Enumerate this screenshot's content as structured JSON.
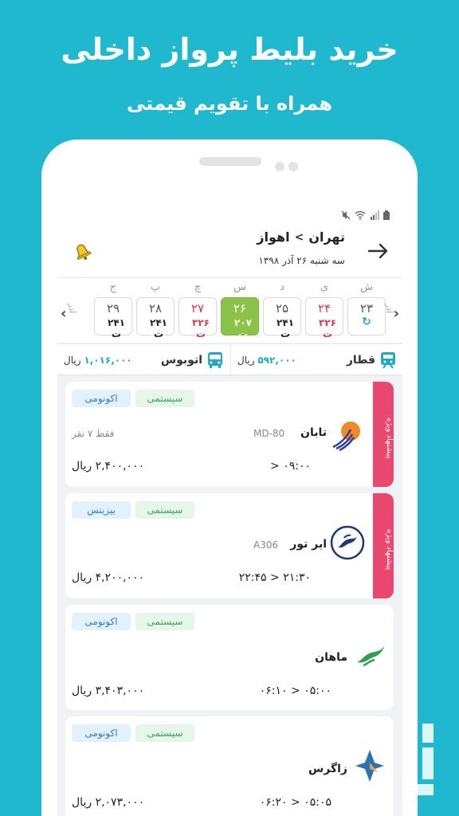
{
  "promo": {
    "title": "خرید بلیط پرواز داخلی",
    "subtitle": "همراه با تقویم قیمتی"
  },
  "header": {
    "origin": "تهران",
    "separator": ">",
    "destination": "اهواز",
    "date": "سه شنبه ۲۶ آذر ۱۳۹۸"
  },
  "calendar": {
    "month_prev": "آذر",
    "month_next": "آذر",
    "days": [
      {
        "weekday": "ش",
        "number": "۲۳",
        "price": "",
        "refresh": "↻",
        "state": "normal"
      },
      {
        "weekday": "ی",
        "number": "۲۴",
        "price": "۳۲۶ ت",
        "state": "red"
      },
      {
        "weekday": "د",
        "number": "۲۵",
        "price": "۲۴۱ ت",
        "state": "normal"
      },
      {
        "weekday": "س",
        "number": "۲۶",
        "price": "۲۰۷ ت",
        "state": "active"
      },
      {
        "weekday": "چ",
        "number": "۲۷",
        "price": "۳۲۶ ت",
        "state": "red"
      },
      {
        "weekday": "پ",
        "number": "۲۸",
        "price": "۲۴۱ ت",
        "state": "normal"
      },
      {
        "weekday": "ج",
        "number": "۲۹",
        "price": "۲۴۱ ت",
        "state": "normal"
      }
    ]
  },
  "transport": {
    "train_label": "قطار",
    "train_price": "۵۹۲,۰۰۰",
    "bus_label": "اتوبوس",
    "bus_price": "۱,۰۱۶,۰۰۰",
    "currency": "ریال"
  },
  "flights": [
    {
      "airline": "تابان",
      "aircraft": "MD-80",
      "seats": "فقط ۷ نفر",
      "class_label": "اکونومی",
      "type_label": "سیستمی",
      "price": "۲,۴۰۰,۰۰۰",
      "currency": "ریال",
      "departure": "۰۹:۰۰",
      "arrow": "<",
      "arrival": "",
      "suggest": "پیشنهاد ویژه",
      "logo": "taban-logo"
    },
    {
      "airline": "ایر تور",
      "aircraft": "A306",
      "seats": "",
      "class_label": "بیزینس",
      "type_label": "سیستمی",
      "price": "۴,۲۰۰,۰۰۰",
      "currency": "ریال",
      "departure": "۲۱:۳۰",
      "arrow": "<",
      "arrival": "۲۲:۴۵",
      "suggest": "پیشنهاد ویژه",
      "logo": "airtour-logo"
    },
    {
      "airline": "ماهان",
      "aircraft": "",
      "seats": "",
      "class_label": "اکونومی",
      "type_label": "سیستمی",
      "price": "۳,۴۰۳,۰۰۰",
      "currency": "ریال",
      "departure": "۰۵:۰۰",
      "arrow": "<",
      "arrival": "۰۶:۱۰",
      "suggest": "",
      "logo": "mahan-logo"
    },
    {
      "airline": "زاگرس",
      "aircraft": "",
      "seats": "",
      "class_label": "اکونومی",
      "type_label": "سیستمی",
      "price": "۲,۰۷۳,۰۰۰",
      "currency": "ریال",
      "departure": "۰۵:۰۵",
      "arrow": "<",
      "arrival": "۰۶:۲۰",
      "suggest": "",
      "logo": "zagros-logo"
    }
  ],
  "colors": {
    "background": "#1FB8CF",
    "accent": "#1FA9C2",
    "active_day": "#8BC34A",
    "red_price": "#D9384A",
    "suggest_ribbon": "#E9486F"
  }
}
